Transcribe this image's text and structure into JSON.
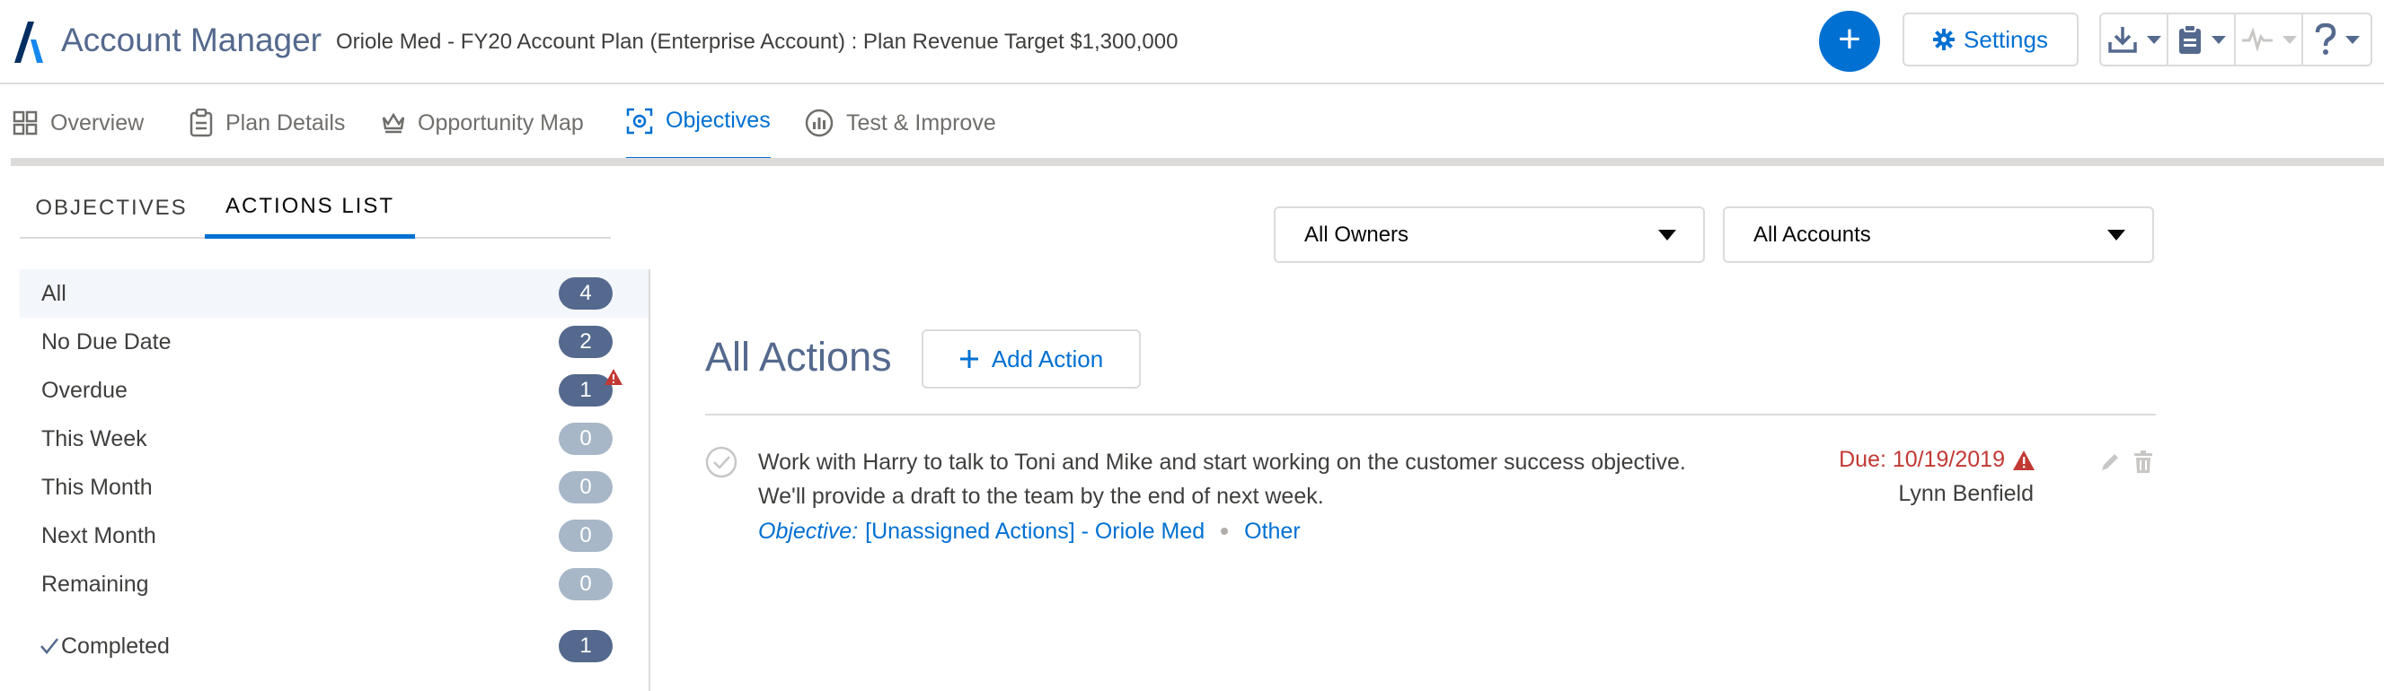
{
  "header": {
    "app_title": "Account Manager",
    "plan_title": "Oriole Med - FY20 Account Plan (Enterprise Account) : Plan Revenue Target $1,300,000",
    "add_symbol": "+",
    "settings_label": "Settings",
    "tools": [
      "download-icon",
      "clipboard-icon",
      "activity-icon",
      "help-icon"
    ]
  },
  "nav": {
    "tabs": [
      {
        "label": "Overview",
        "icon": "grid-icon"
      },
      {
        "label": "Plan Details",
        "icon": "clipboard-icon"
      },
      {
        "label": "Opportunity Map",
        "icon": "crown-icon"
      },
      {
        "label": "Objectives",
        "icon": "target-icon",
        "active": true
      },
      {
        "label": "Test & Improve",
        "icon": "chart-icon"
      }
    ]
  },
  "subtabs": {
    "objectives": "OBJECTIVES",
    "actions_list": "ACTIONS LIST"
  },
  "sidebar": {
    "items": [
      {
        "label": "All",
        "count": "4"
      },
      {
        "label": "No Due Date",
        "count": "2"
      },
      {
        "label": "Overdue",
        "count": "1"
      },
      {
        "label": "This Week",
        "count": "0"
      },
      {
        "label": "This Month",
        "count": "0"
      },
      {
        "label": "Next Month",
        "count": "0"
      },
      {
        "label": "Remaining",
        "count": "0"
      },
      {
        "label": "Completed",
        "count": "1"
      }
    ]
  },
  "filters": {
    "owners": "All Owners",
    "accounts": "All Accounts"
  },
  "main": {
    "heading": "All Actions",
    "add_action_label": "Add Action",
    "action": {
      "text": "Work with Harry to talk to Toni and Mike and start working on the customer success objective. We'll provide a draft to the team by the end of next week.",
      "objective_label": "Objective:",
      "objective_value": "[Unassigned Actions] - Oriole Med",
      "category": "Other",
      "due": "Due: 10/19/2019",
      "owner": "Lynn Benfield"
    }
  },
  "colors": {
    "brand_blue": "#0070d2",
    "warning_red": "#c23934",
    "badge_dark": "#54698d",
    "badge_light": "#a8b7c7"
  }
}
